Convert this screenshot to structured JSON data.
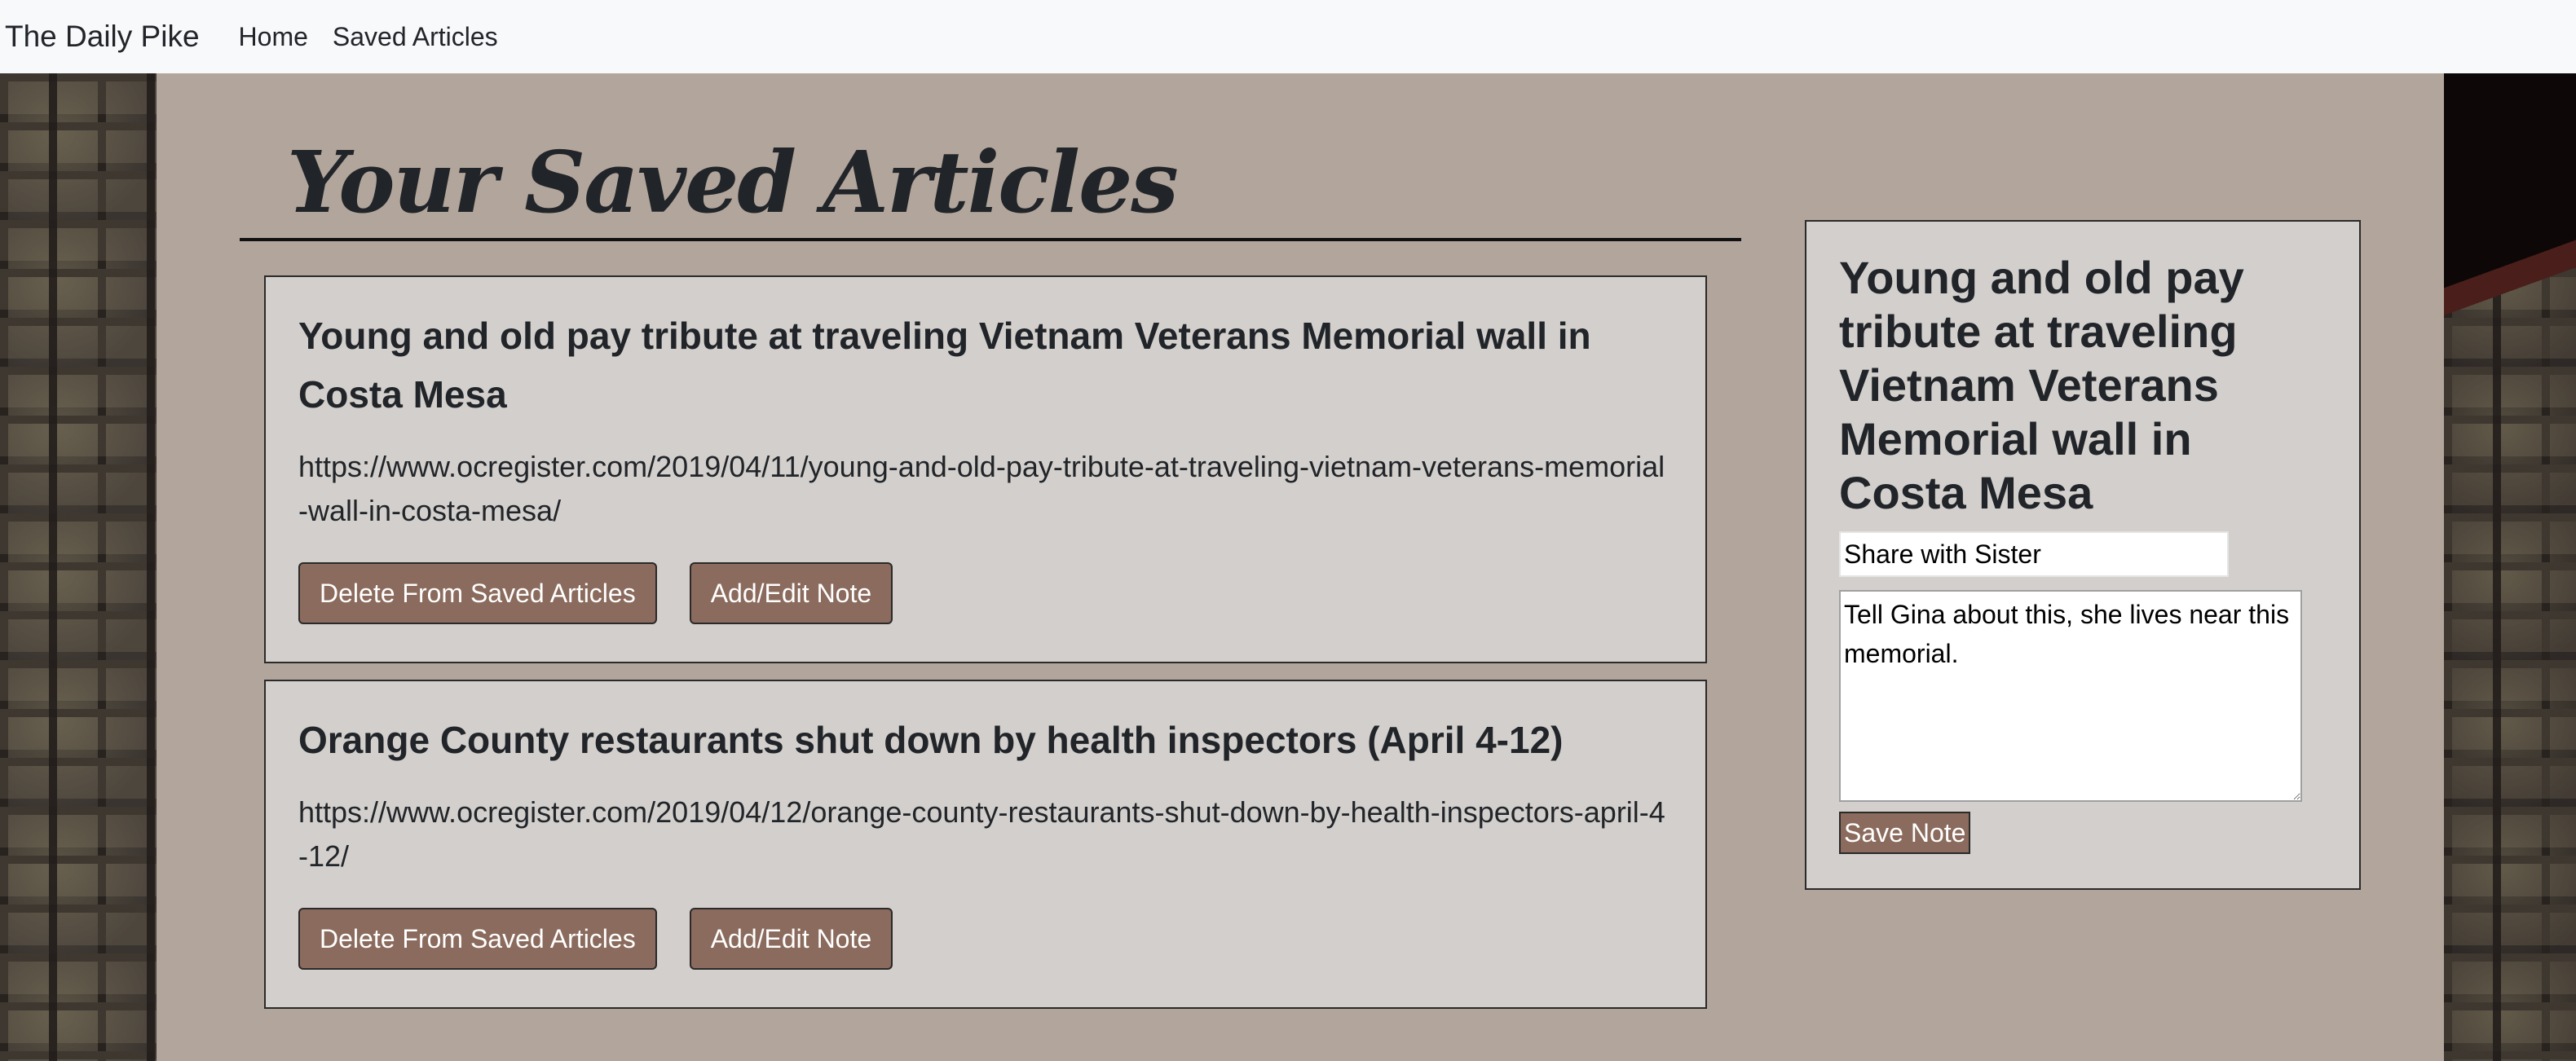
{
  "navbar": {
    "brand": "The Daily Pike",
    "links": [
      "Home",
      "Saved Articles"
    ]
  },
  "main": {
    "title": "Your Saved Articles",
    "articles": [
      {
        "title": "Young and old pay tribute at traveling Vietnam Veterans Memorial wall in Costa Mesa",
        "url": "https://www.ocregister.com/2019/04/11/young-and-old-pay-tribute-at-traveling-vietnam-veterans-memorial-wall-in-costa-mesa/",
        "delete_label": "Delete From Saved Articles",
        "note_label": "Add/Edit Note"
      },
      {
        "title": "Orange County restaurants shut down by health inspectors (April 4-12)",
        "url": "https://www.ocregister.com/2019/04/12/orange-county-restaurants-shut-down-by-health-inspectors-april-4-12/",
        "delete_label": "Delete From Saved Articles",
        "note_label": "Add/Edit Note"
      }
    ]
  },
  "note_panel": {
    "article_title": "Young and old pay tribute at traveling Vietnam Veterans Memorial wall in Costa Mesa",
    "note_title_value": "Share with Sister",
    "note_body_value": "Tell Gina about this, she lives near this memorial.",
    "save_label": "Save Note"
  },
  "colors": {
    "navbar_bg": "#f8f9fa",
    "panel_bg": "#b2a59b",
    "card_bg": "#d3cfcc",
    "button_bg": "#8b6b5d",
    "text": "#212529"
  }
}
